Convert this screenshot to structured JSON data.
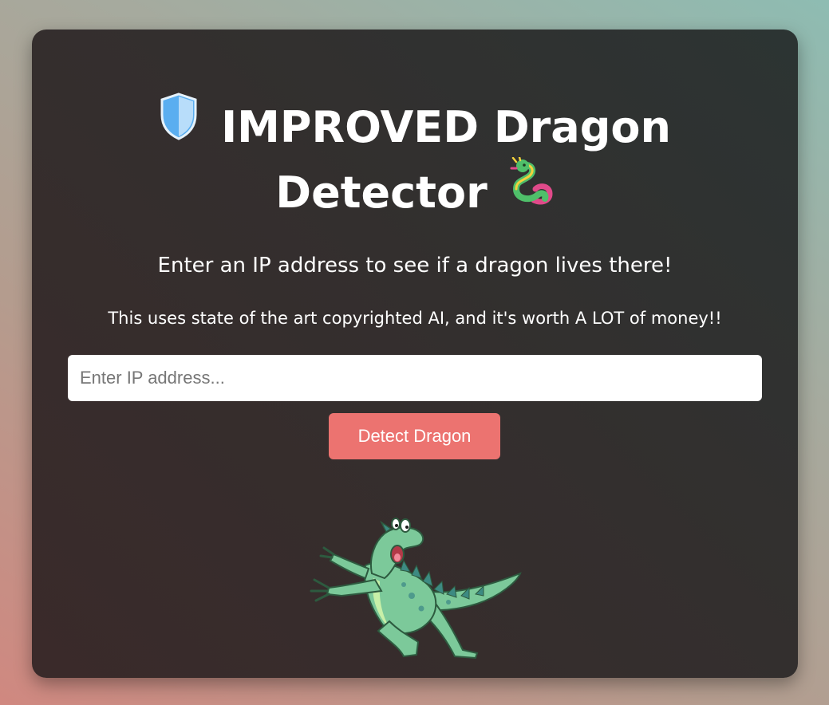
{
  "header": {
    "shield_icon": "shield-icon",
    "title_line1": "IMPROVED Dragon",
    "title_line2": "Detector",
    "dragon_icon": "dragon-icon"
  },
  "main": {
    "subtitle": "Enter an IP address to see if a dragon lives there!",
    "tagline": "This uses state of the art copyrighted AI, and it's worth A LOT of money!!",
    "ip_input": {
      "placeholder": "Enter IP address...",
      "value": ""
    },
    "detect_button_label": "Detect Dragon",
    "illustration": "running-dragon-illustration"
  },
  "colors": {
    "button": "#ec7370",
    "card": "#332f2e",
    "dragon_green": "#7cc99a"
  }
}
